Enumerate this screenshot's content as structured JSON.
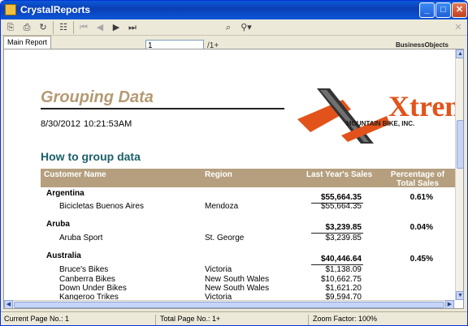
{
  "window": {
    "title": "CrystalReports"
  },
  "toolbar": {
    "page_input": "1",
    "page_count": "/1+",
    "brand": "BusinessObjects"
  },
  "tabs": [
    {
      "label": "Main Report"
    }
  ],
  "report": {
    "title": "Grouping Data",
    "date": "8/30/2012",
    "time": "10:21:53AM",
    "subtitle": "How to group data",
    "logo_text": "Xtreme",
    "logo_subtext": "MOUNTAIN BIKE, INC.",
    "headers": {
      "customer": "Customer Name",
      "region": "Region",
      "sales": "Last Year's Sales",
      "pct": "Percentage of Total Sales"
    },
    "groups": [
      {
        "name": "Argentina",
        "total": "$55,664.35",
        "pct": "0.61%",
        "rows": [
          {
            "customer": "Bicicletas Buenos Aires",
            "region": "Mendoza",
            "sales": "$55,664.35"
          }
        ]
      },
      {
        "name": "Aruba",
        "total": "$3,239.85",
        "pct": "0.04%",
        "rows": [
          {
            "customer": "Aruba Sport",
            "region": "St. George",
            "sales": "$3,239.85"
          }
        ]
      },
      {
        "name": "Australia",
        "total": "$40,446.64",
        "pct": "0.45%",
        "rows": [
          {
            "customer": "Bruce's Bikes",
            "region": "Victoria",
            "sales": "$1,138.09"
          },
          {
            "customer": "Canberra Bikes",
            "region": "New South Wales",
            "sales": "$10,662.75"
          },
          {
            "customer": "Down Under Bikes",
            "region": "New South Wales",
            "sales": "$1,621.20"
          },
          {
            "customer": "Kangeroo Trikes",
            "region": "Victoria",
            "sales": "$9,594.70"
          }
        ]
      }
    ]
  },
  "status": {
    "current_page": "Current Page No.: 1",
    "total_page": "Total Page No.: 1+",
    "zoom": "Zoom Factor: 100%"
  },
  "colors": {
    "title_bar": "#0a3fb5",
    "report_title": "#b59a72",
    "subtitle": "#1b5f6a",
    "header_band": "#b59f7e",
    "logo_orange": "#e2531b"
  }
}
